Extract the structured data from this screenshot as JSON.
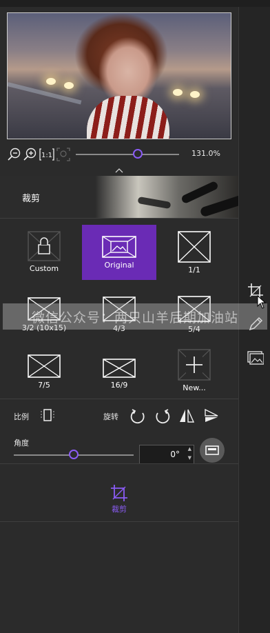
{
  "zoom": {
    "value_label": "131.0%",
    "level_percent": 131.0
  },
  "banner": {
    "title": "裁剪"
  },
  "crop_presets": [
    {
      "label": "Custom",
      "icon": "lock-icon",
      "selected": false
    },
    {
      "label": "Original",
      "icon": "image-icon",
      "selected": true
    },
    {
      "label": "1/1",
      "icon": "ratio-square-icon",
      "selected": false
    },
    {
      "label": "3/2 (10x15)",
      "icon": "ratio-3-2-icon",
      "selected": false
    },
    {
      "label": "4/3",
      "icon": "ratio-4-3-icon",
      "selected": false
    },
    {
      "label": "5/4",
      "icon": "ratio-5-4-icon",
      "selected": false
    },
    {
      "label": "7/5",
      "icon": "ratio-7-5-icon",
      "selected": false
    },
    {
      "label": "16/9",
      "icon": "ratio-16-9-icon",
      "selected": false
    },
    {
      "label": "New...",
      "icon": "plus-icon",
      "selected": false
    }
  ],
  "controls": {
    "ratio_label": "比例",
    "rotate_label": "旋转",
    "angle_label": "角度",
    "angle_value": "0°",
    "angle_fraction": 0.5
  },
  "crop_action": {
    "label": "裁剪"
  },
  "watermark": {
    "text": "微信公众号：两只山羊后期加油站"
  },
  "colors": {
    "accent": "#8b5cf6",
    "selected_bg": "#6a2bb5",
    "panel_bg": "#2b2b2b"
  }
}
